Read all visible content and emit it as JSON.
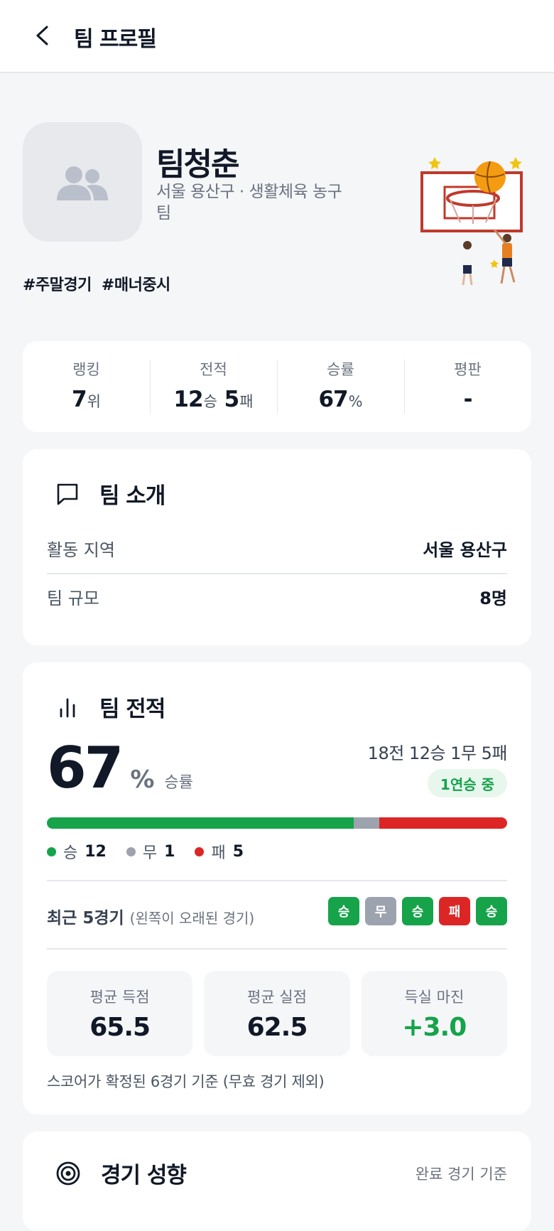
{
  "header": {
    "title": "팀 프로필"
  },
  "team": {
    "name": "팀청춘",
    "subtitle": "서울 용산구 · 생활체육 농구 팀",
    "tags": [
      "#주말경기",
      "#매너중시"
    ]
  },
  "stats": {
    "rank_label": "랭킹",
    "rank_value": "7",
    "rank_unit": "위",
    "record_label": "전적",
    "wins": "12",
    "win_unit": "승",
    "losses": "5",
    "loss_unit": "패",
    "rate_label": "승률",
    "rate_value": "67",
    "rate_unit": "%",
    "rep_label": "평판",
    "rep_value": "-"
  },
  "intro": {
    "title": "팀 소개",
    "rows": [
      {
        "label": "활동 지역",
        "value": "서울 용산구"
      },
      {
        "label": "팀 규모",
        "value": "8명"
      }
    ]
  },
  "record": {
    "title": "팀 전적",
    "win_rate": "67",
    "pct_sign": "%",
    "win_rate_label": "승률",
    "summary": "18전 12승 1무 5패",
    "streak": "1연승 중",
    "bar": {
      "win": 12,
      "draw": 1,
      "loss": 5
    },
    "legend": [
      {
        "label": "승",
        "value": "12",
        "color": "#16a34a"
      },
      {
        "label": "무",
        "value": "1",
        "color": "#9ca3af"
      },
      {
        "label": "패",
        "value": "5",
        "color": "#dc2626"
      }
    ],
    "recent_label": "최근 5경기",
    "recent_note": "(왼쪽이 오래된 경기)",
    "recent": [
      "승",
      "무",
      "승",
      "패",
      "승"
    ],
    "metrics": [
      {
        "label": "평균 득점",
        "value": "65.5"
      },
      {
        "label": "평균 실점",
        "value": "62.5"
      },
      {
        "label": "득실 마진",
        "value": "+3.0"
      }
    ],
    "note": "스코어가 확정된 6경기 기준 (무효 경기 제외)"
  },
  "style": {
    "title": "경기 성향",
    "right_label": "완료 경기 기준"
  },
  "colors": {
    "win": "#16a34a",
    "draw": "#9ca3af",
    "loss": "#dc2626",
    "accent_bg": "#e8f7ee"
  }
}
